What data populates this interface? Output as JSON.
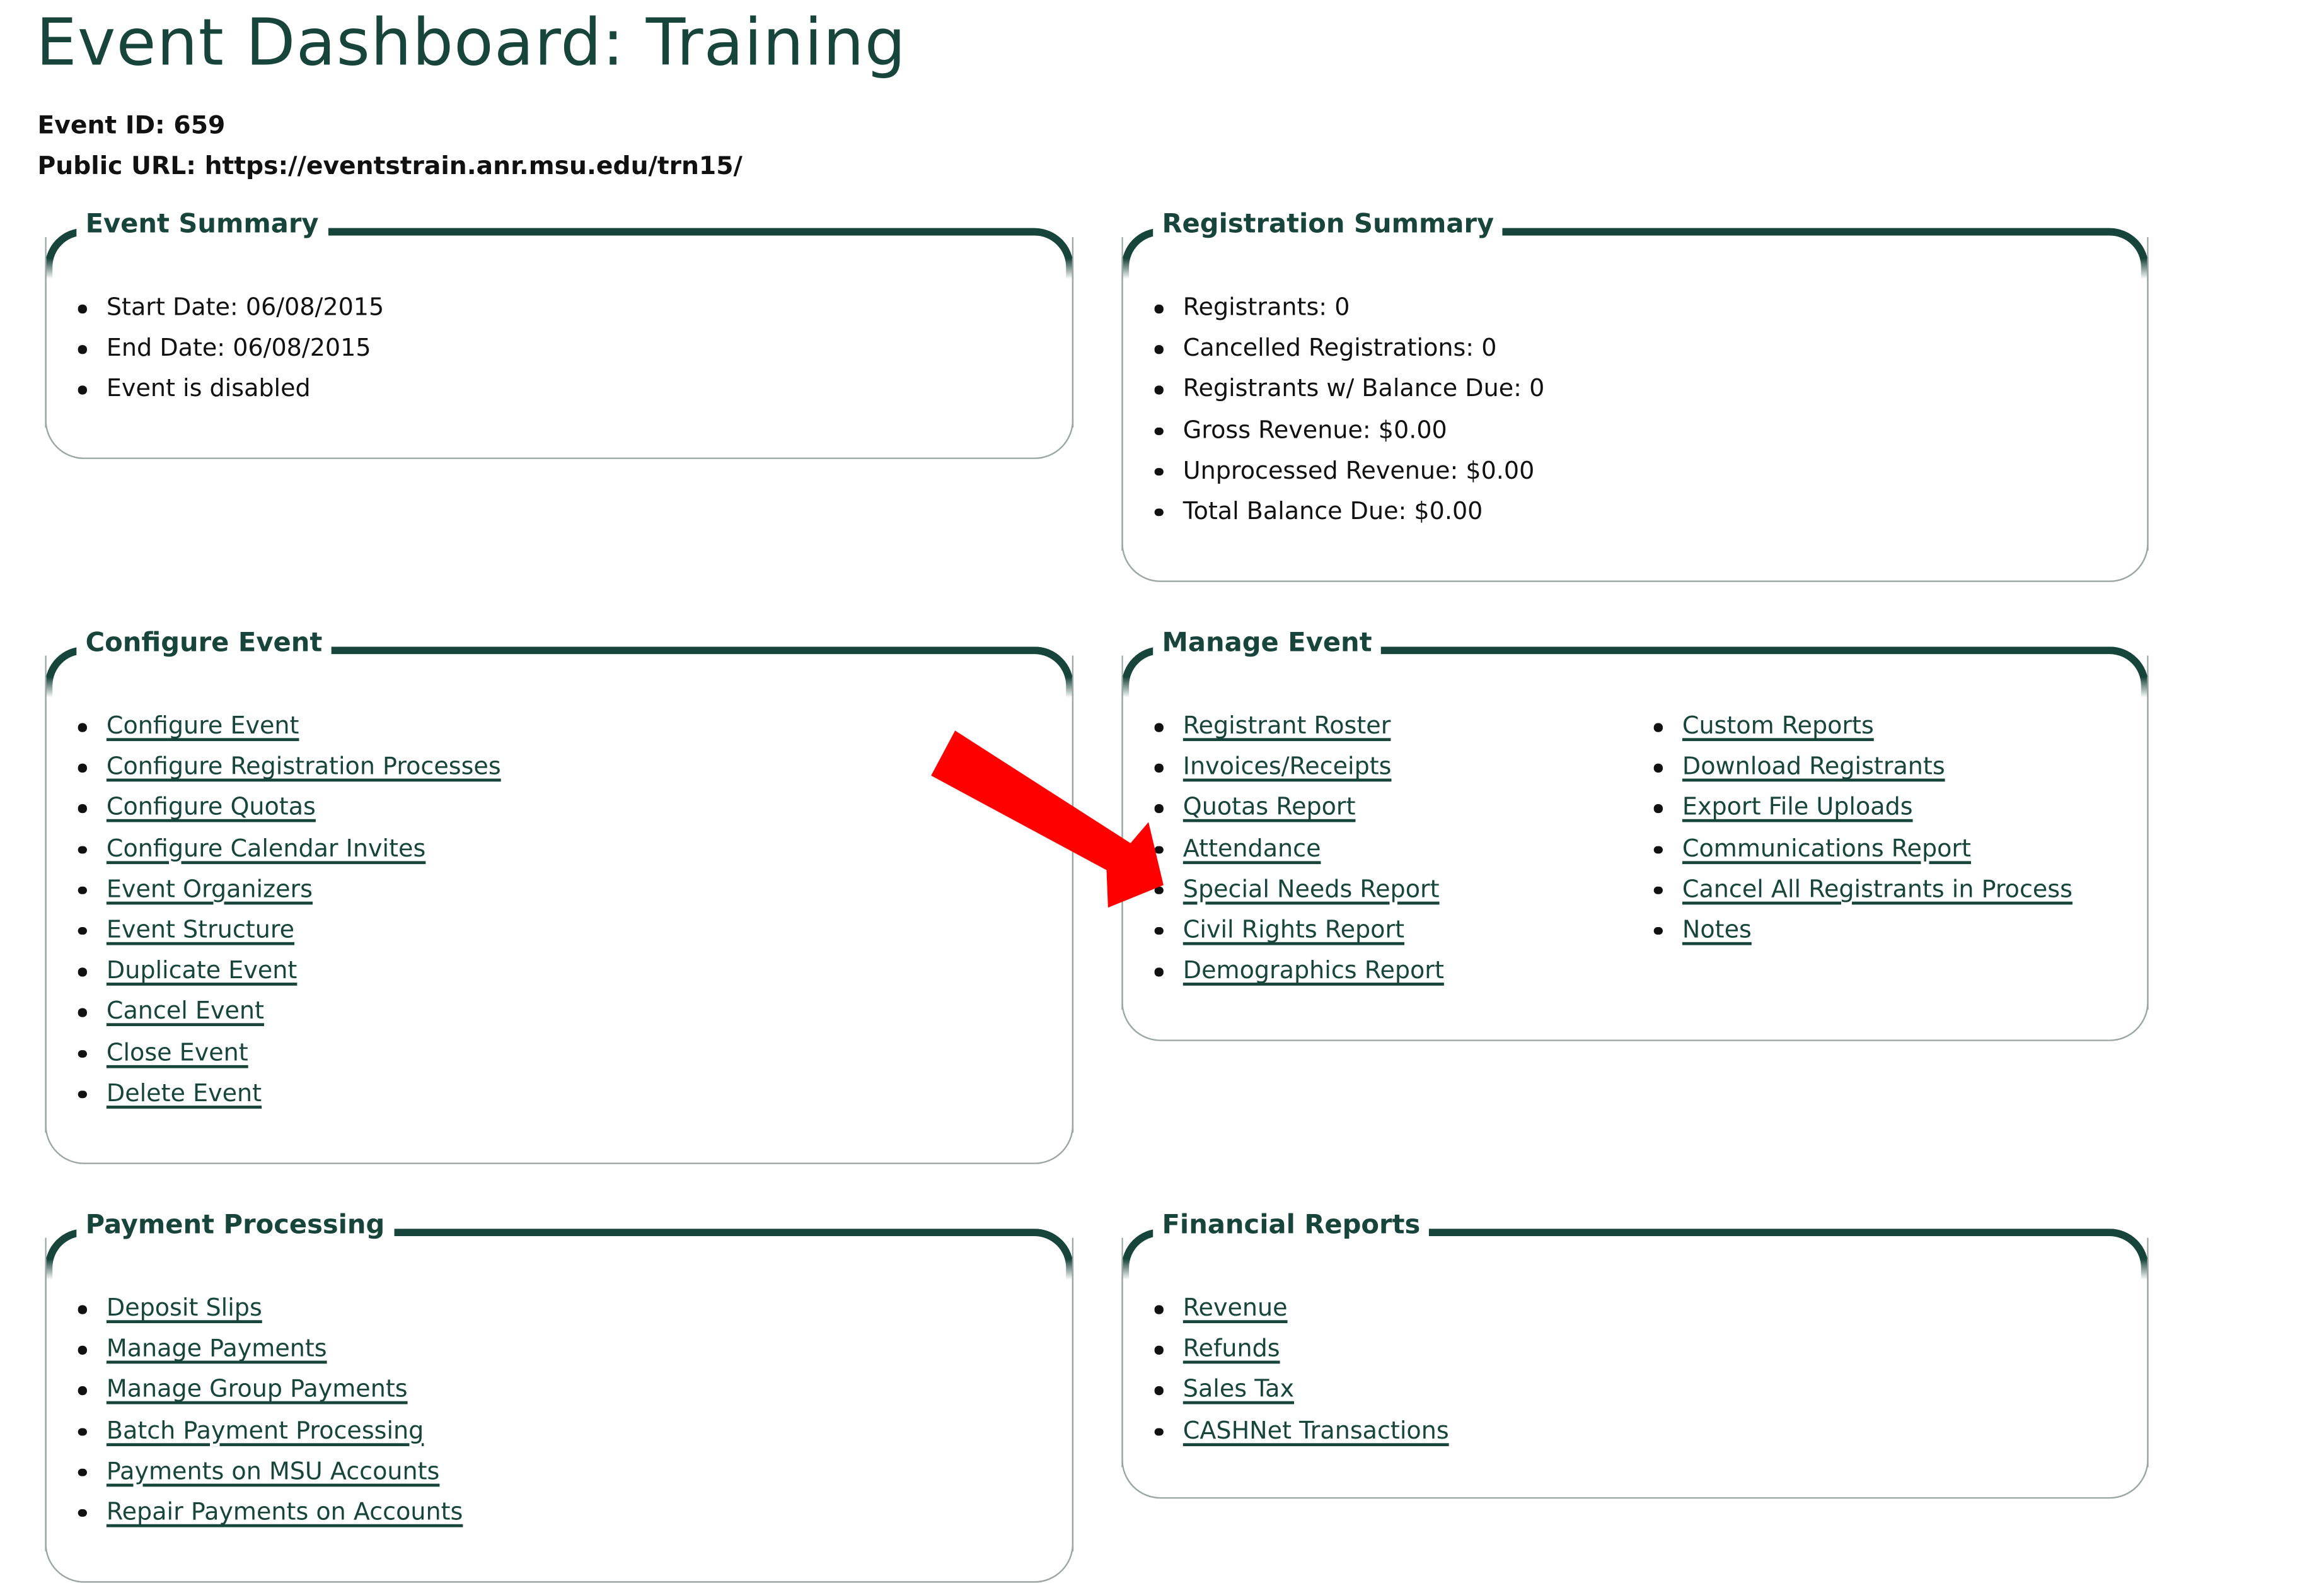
{
  "header": {
    "title": "Event Dashboard: Training",
    "event_id_line": "Event ID: 659",
    "public_url_line": "Public URL: https://eventstrain.anr.msu.edu/trn15/"
  },
  "colors": {
    "brand_green": "#18453B",
    "annotation_arrow": "#FF0000",
    "panel_border": "#9AA6A3"
  },
  "event_summary": {
    "title": "Event Summary",
    "items": [
      "Start Date: 06/08/2015",
      "End Date: 06/08/2015",
      "Event is disabled"
    ]
  },
  "registration_summary": {
    "title": "Registration Summary",
    "items": [
      "Registrants: 0",
      "Cancelled Registrations: 0",
      "Registrants w/ Balance Due: 0",
      "Gross Revenue: $0.00",
      "Unprocessed Revenue: $0.00",
      "Total Balance Due: $0.00"
    ]
  },
  "configure_event": {
    "title": "Configure Event",
    "links": [
      "Configure Event",
      "Configure Registration Processes",
      "Configure Quotas",
      "Configure Calendar Invites",
      "Event Organizers",
      "Event Structure",
      "Duplicate Event",
      "Cancel Event",
      "Close Event",
      "Delete Event"
    ]
  },
  "manage_event": {
    "title": "Manage Event",
    "column1": [
      "Registrant Roster",
      "Invoices/Receipts",
      "Quotas Report",
      "Attendance",
      "Special Needs Report",
      "Civil Rights Report",
      "Demographics Report"
    ],
    "column2": [
      "Custom Reports",
      "Download Registrants",
      "Export File Uploads",
      "Communications Report",
      "Cancel All Registrants in Process",
      "Notes"
    ]
  },
  "payment_processing": {
    "title": "Payment Processing",
    "links": [
      "Deposit Slips",
      "Manage Payments",
      "Manage Group Payments",
      "Batch Payment Processing",
      "Payments on MSU Accounts",
      "Repair Payments on Accounts"
    ]
  },
  "financial_reports": {
    "title": "Financial Reports",
    "links": [
      "Revenue",
      "Refunds",
      "Sales Tax",
      "CASHNet Transactions"
    ]
  },
  "annotation": {
    "icon": "red-arrow-icon",
    "points_to": "Special Needs Report"
  }
}
